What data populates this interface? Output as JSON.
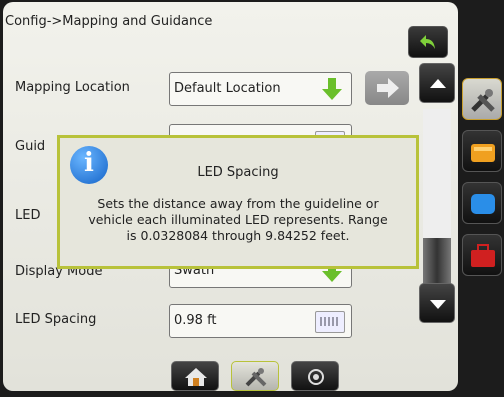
{
  "header": {
    "title": "Config->Mapping and Guidance"
  },
  "rows": {
    "mapping_location": {
      "label": "Mapping Location",
      "value": "Default Location"
    },
    "guidance": {
      "label": "Guid"
    },
    "led": {
      "label": "LED"
    },
    "display_mode": {
      "label": "Display Mode",
      "value": "Swath"
    },
    "led_spacing": {
      "label": "LED Spacing",
      "value": "0.98 ft"
    }
  },
  "modal": {
    "title": "LED Spacing",
    "line1": "Sets the distance away from the guideline or",
    "line2": "vehicle each illuminated LED represents. Range",
    "line3": "is 0.0328084 through 9.84252 feet."
  },
  "colors": {
    "accent": "#b8c23a",
    "arrow_green": "#6abf2a",
    "info_blue": "#1463c8"
  },
  "icons": {
    "side_tabs": [
      "tools-icon",
      "machine-icon",
      "display-icon",
      "toolbox-icon"
    ],
    "bottom_tabs": [
      "home-icon",
      "tools-icon",
      "gps-icon"
    ]
  }
}
